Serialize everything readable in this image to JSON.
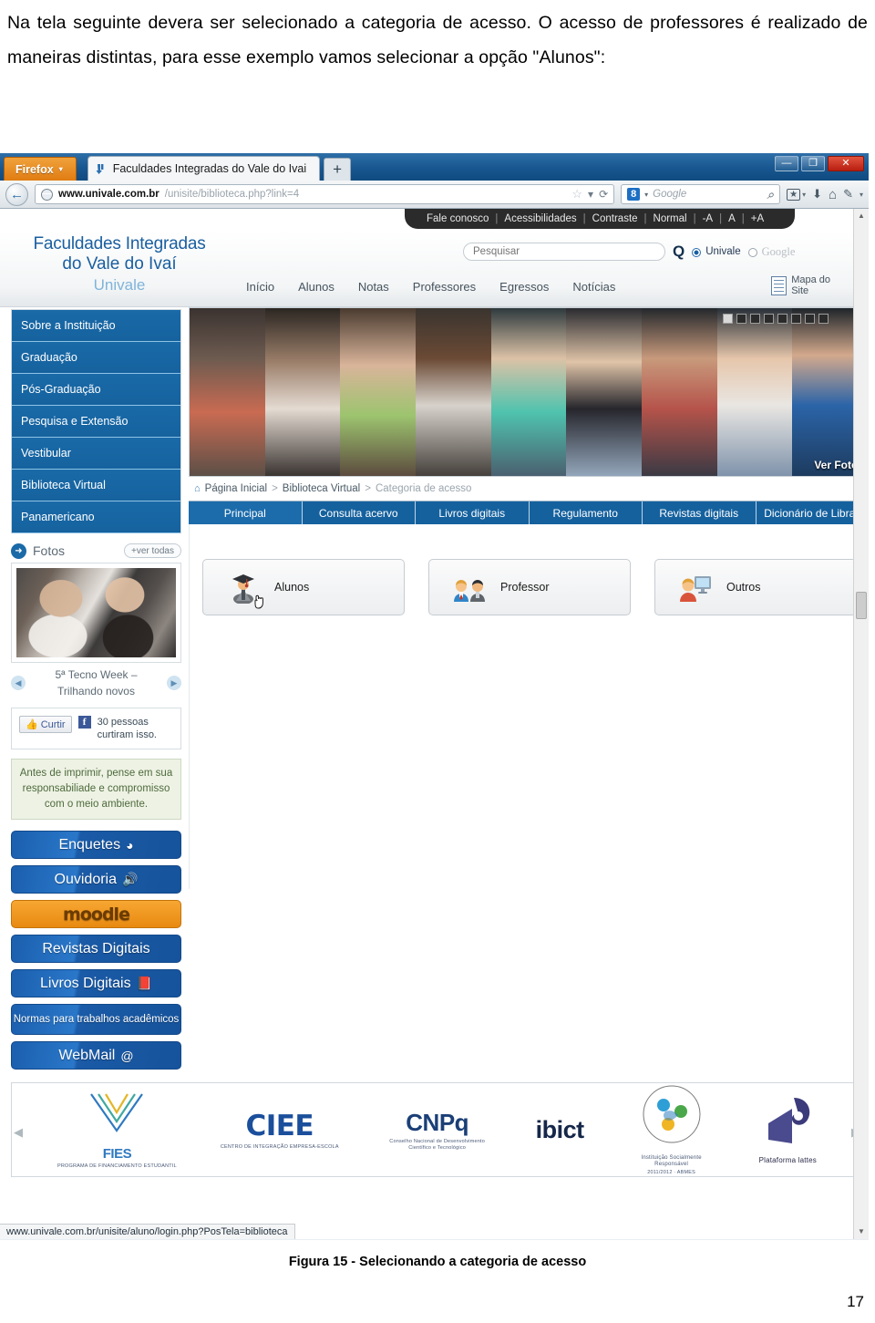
{
  "document": {
    "paragraph": "Na tela seguinte devera ser selecionado a categoria de acesso. O acesso de professores é realizado de maneiras distintas, para esse exemplo vamos selecionar a opção \"Alunos\":",
    "figure_caption": "Figura 15 - Selecionando a categoria de acesso",
    "page_number": "17"
  },
  "browser": {
    "app_button": "Firefox",
    "app_caret": "▾",
    "tab_title": "Faculdades Integradas do Vale do Ivai",
    "new_tab": "+",
    "window_minimize": "—",
    "window_restore": "❐",
    "window_close": "✕",
    "back_arrow": "←",
    "url_host": "www.univale.com.br",
    "url_path": "/unisite/biblioteca.php?link=4",
    "star": "☆",
    "urlbar_caret": "▾",
    "reload": "⟳",
    "search_engine": "Google",
    "search_engine_badge": "8",
    "search_magnifier": "⌕",
    "bookmark_icon": "★",
    "download_icon": "⬇",
    "home_icon": "⌂",
    "customize_icon": "✎",
    "overflow_caret": "▾",
    "status_url": "www.univale.com.br/unisite/aluno/login.php?PosTela=biblioteca",
    "scroll_up": "▲",
    "scroll_down": "▼"
  },
  "utility_bar": {
    "items": [
      "Fale conosco",
      "Acessibilidades",
      "Contraste",
      "Normal",
      "-A",
      "A",
      "+A"
    ],
    "separator": "|"
  },
  "site_header": {
    "logo_line1": "Faculdades Integradas",
    "logo_line2": "do Vale do Ivaí",
    "logo_line3": "Univale",
    "search_placeholder": "Pesquisar",
    "search_value": "",
    "magnifier": "Q",
    "radio_univale": "Univale",
    "radio_google": "Google",
    "nav": [
      "Início",
      "Alunos",
      "Notas",
      "Professores",
      "Egressos",
      "Notícias"
    ],
    "site_map_line1": "Mapa do",
    "site_map_line2": "Site"
  },
  "sidebar": {
    "items": [
      "Sobre a Instituição",
      "Graduação",
      "Pós-Graduação",
      "Pesquisa e Extensão",
      "Vestibular",
      "Biblioteca Virtual",
      "Panamericano"
    ],
    "fotos_title": "Fotos",
    "fotos_arrow": "➜",
    "ver_todas": "+ver todas",
    "photo_caption_line1": "5ª Tecno Week –",
    "photo_caption_line2": "Trilhando novos",
    "carousel_prev": "◀",
    "carousel_next": "▶",
    "facebook_like": "Curtir",
    "facebook_f": "f",
    "facebook_text": "30 pessoas curtiram isso.",
    "eco_text": "Antes de imprimir, pense em sua responsabiliade e compromisso com o meio ambiente.",
    "blocks": [
      {
        "label": "Enquetes",
        "icon": "◕",
        "style": "blue"
      },
      {
        "label": "Ouvidoria",
        "icon": "🔊",
        "style": "blue"
      },
      {
        "label": "moodle",
        "icon": "",
        "style": "orange"
      },
      {
        "label": "Revistas Digitais",
        "icon": "",
        "style": "blue"
      },
      {
        "label": "Livros Digitais",
        "icon": "📕",
        "style": "blue"
      },
      {
        "label": "Normas para trabalhos acadêmicos",
        "icon": "",
        "style": "blue-small"
      },
      {
        "label": "WebMail",
        "icon": "@",
        "style": "blue"
      }
    ]
  },
  "hero": {
    "ver_fotos": "Ver Fotos",
    "dots_total": 8,
    "dot_active_index": 0
  },
  "breadcrumb": {
    "home_icon": "⌂",
    "items": [
      "Página Inicial",
      "Biblioteca Virtual",
      "Categoria de acesso"
    ],
    "separator": ">"
  },
  "tabs": {
    "items": [
      "Principal",
      "Consulta acervo",
      "Livros digitais",
      "Regulamento",
      "Revistas digitais",
      "Dicionário de Libras"
    ],
    "active_index": 0
  },
  "categories": [
    {
      "label": "Alunos",
      "icon": "graduate-icon"
    },
    {
      "label": "Professor",
      "icon": "teachers-icon"
    },
    {
      "label": "Outros",
      "icon": "user-monitor-icon"
    }
  ],
  "footer_logos": [
    {
      "name": "FIES",
      "sub": "PROGRAMA DE FINANCIAMENTO ESTUDANTIL"
    },
    {
      "name": "CIEE",
      "sub": "CENTRO DE INTEGRAÇÃO EMPRESA-ESCOLA"
    },
    {
      "name": "CNPq",
      "sub": "Conselho Nacional de Desenvolvimento Científico e Tecnológico"
    },
    {
      "name": "ibict",
      "sub": ""
    },
    {
      "name": "Instituição Socialmente Responsável",
      "sub": "2011/2012 · ABMES"
    },
    {
      "name": "Plataforma lattes",
      "sub": ""
    }
  ],
  "colors": {
    "brand_blue": "#15619e",
    "sidebar_blue": "#1a6aa8",
    "firefox_orange": "#e07c12",
    "titlebar_blue": "#17568f",
    "eco_green": "#4d6b3c"
  }
}
